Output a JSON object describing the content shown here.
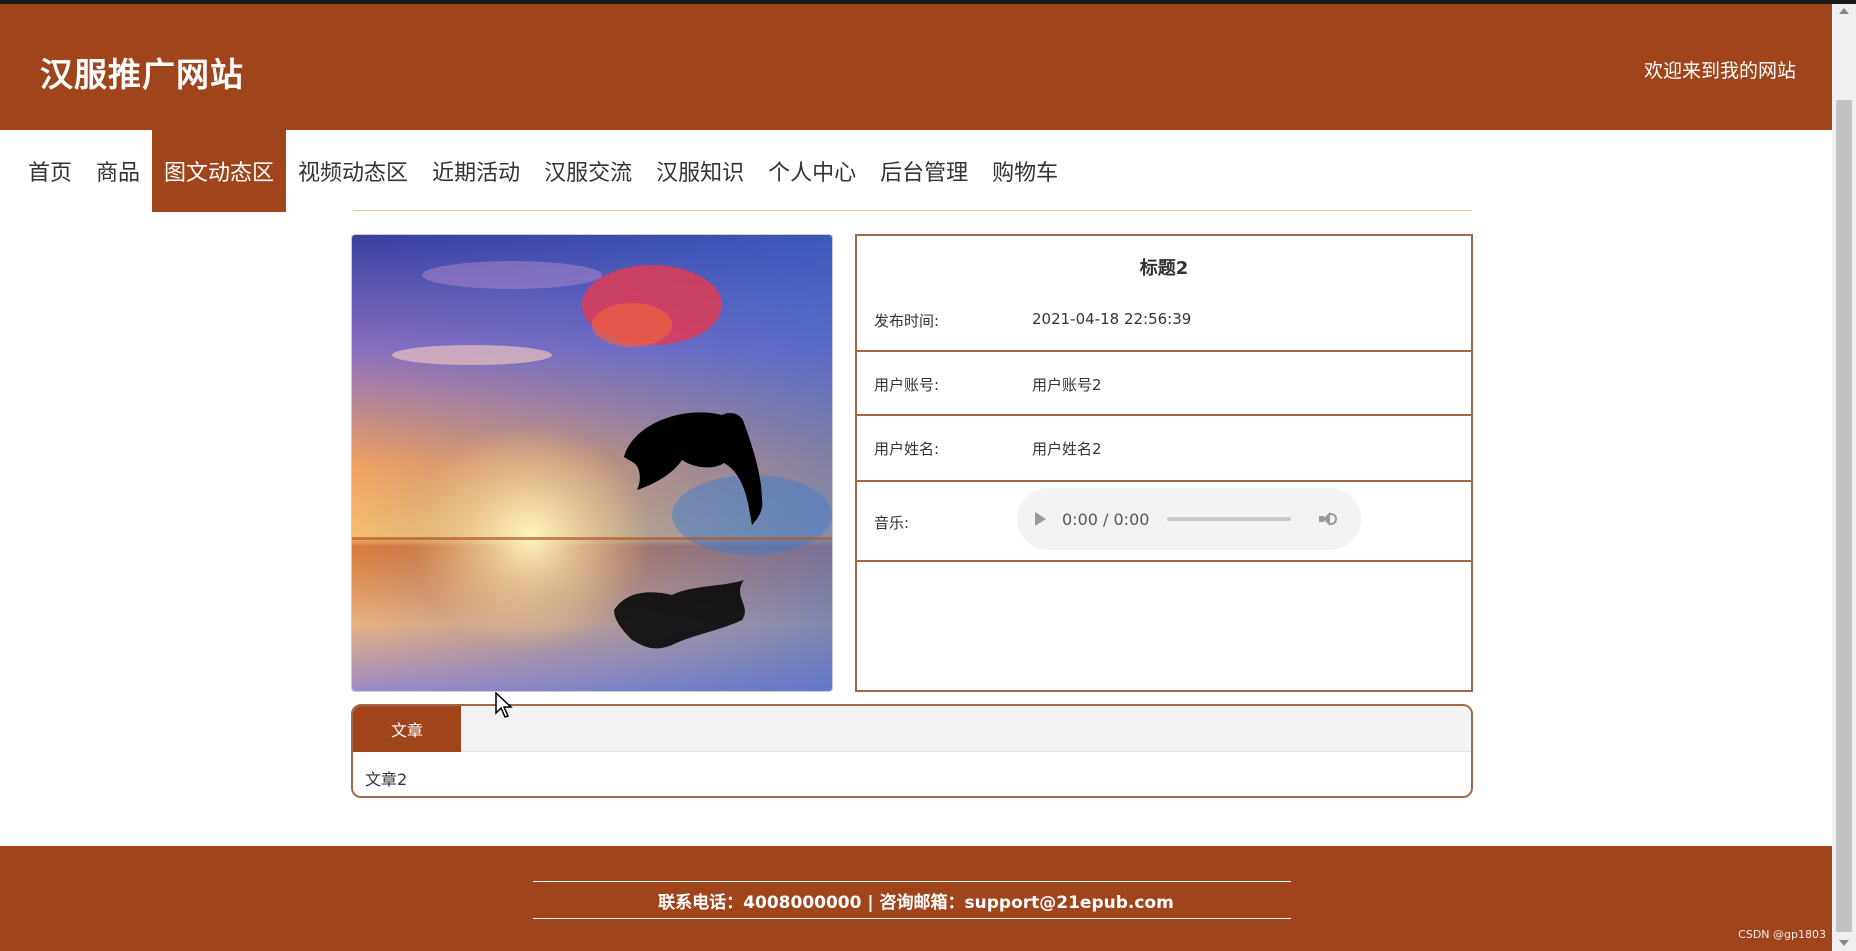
{
  "header": {
    "site_title": "汉服推广网站",
    "welcome": "欢迎来到我的网站"
  },
  "nav": {
    "items": [
      {
        "label": "首页"
      },
      {
        "label": "商品"
      },
      {
        "label": "图文动态区"
      },
      {
        "label": "视频动态区"
      },
      {
        "label": "近期活动"
      },
      {
        "label": "汉服交流"
      },
      {
        "label": "汉服知识"
      },
      {
        "label": "个人中心"
      },
      {
        "label": "后台管理"
      },
      {
        "label": "购物车"
      }
    ],
    "active": "图文动态区"
  },
  "detail": {
    "title": "标题2",
    "publish_time_label": "发布时间:",
    "publish_time_value": "2021-04-18 22:56:39",
    "account_label": "用户账号:",
    "account_value": "用户账号2",
    "name_label": "用户姓名:",
    "name_value": "用户姓名2",
    "music_label": "音乐:",
    "audio_time": "0:00 / 0:00"
  },
  "tabs": {
    "active_label": "文章",
    "content": "文章2"
  },
  "footer": {
    "contact": "联系电话：4008000000 | 咨询邮箱：support@21epub.com"
  },
  "watermark": "CSDN @gp1803",
  "colors": {
    "brand": "#a0441c",
    "border": "#a06a4a",
    "divider": "#e6c98a"
  },
  "icons": {
    "play": "play-icon",
    "volume": "volume-icon"
  }
}
